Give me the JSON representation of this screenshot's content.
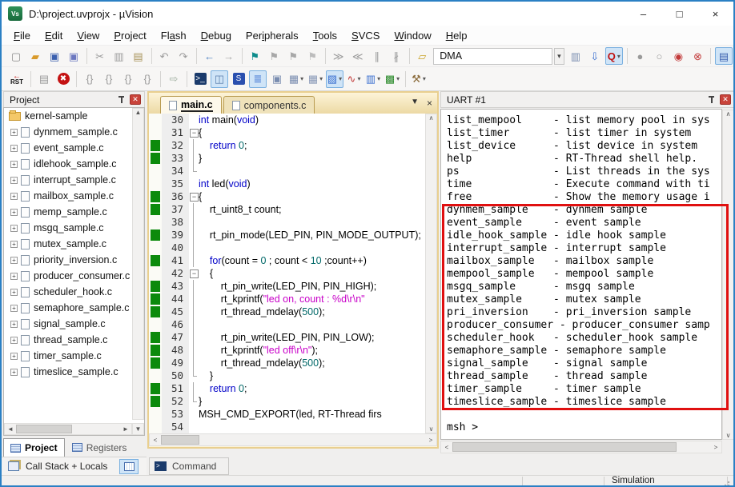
{
  "window": {
    "title": "D:\\project.uvprojx - µVision",
    "logo_text": "Vs",
    "minimize": "–",
    "maximize": "□",
    "close": "×"
  },
  "menu": {
    "items": [
      {
        "label": "File",
        "u": 0
      },
      {
        "label": "Edit",
        "u": 0
      },
      {
        "label": "View",
        "u": 0
      },
      {
        "label": "Project",
        "u": 0
      },
      {
        "label": "Flash",
        "u": 2
      },
      {
        "label": "Debug",
        "u": 0
      },
      {
        "label": "Peripherals",
        "u": 3
      },
      {
        "label": "Tools",
        "u": 0
      },
      {
        "label": "SVCS",
        "u": 0
      },
      {
        "label": "Window",
        "u": 0
      },
      {
        "label": "Help",
        "u": 0
      }
    ]
  },
  "toolbar1": {
    "target_combo_value": "DMA",
    "items": [
      {
        "name": "new-file-button",
        "glyph": "▢",
        "color": "#8a8a8a"
      },
      {
        "name": "open-file-button",
        "glyph": "▰",
        "color": "#d99a2b"
      },
      {
        "name": "save-button",
        "glyph": "▣",
        "color": "#3a5fae"
      },
      {
        "name": "save-all-button",
        "glyph": "▣",
        "color": "#6b77c0"
      },
      {
        "sep": true
      },
      {
        "name": "cut-button",
        "glyph": "✂",
        "color": "#9a9a9a"
      },
      {
        "name": "copy-button",
        "glyph": "▥",
        "color": "#9a9a9a"
      },
      {
        "name": "paste-button",
        "glyph": "▤",
        "color": "#a8935a"
      },
      {
        "sep": true
      },
      {
        "name": "undo-button",
        "glyph": "↶",
        "color": "#9a9a9a"
      },
      {
        "name": "redo-button",
        "glyph": "↷",
        "color": "#9a9a9a"
      },
      {
        "sep": true
      },
      {
        "name": "navigate-back-button",
        "glyph": "←",
        "color": "#4a7fc1"
      },
      {
        "name": "navigate-forward-button",
        "glyph": "→",
        "color": "#a8a8a8"
      },
      {
        "sep": true
      },
      {
        "name": "bookmark-toggle-button",
        "glyph": "⚑",
        "color": "#0e8c8c"
      },
      {
        "name": "bookmark-next-button",
        "glyph": "⚑",
        "color": "#a8a8a8"
      },
      {
        "name": "bookmark-prev-button",
        "glyph": "⚑",
        "color": "#a8a8a8"
      },
      {
        "name": "bookmark-clear-button",
        "glyph": "⚑",
        "color": "#bcbcbc"
      },
      {
        "sep": true
      },
      {
        "name": "indent-button",
        "glyph": "≫",
        "color": "#9a9a9a"
      },
      {
        "name": "outdent-button",
        "glyph": "≪",
        "color": "#9a9a9a"
      },
      {
        "name": "comment-button",
        "glyph": "∥",
        "color": "#9a9a9a"
      },
      {
        "name": "uncomment-button",
        "glyph": "∦",
        "color": "#9a9a9a"
      },
      {
        "sep": true
      },
      {
        "name": "flash-config-button",
        "glyph": "▱",
        "color": "#c9a227"
      },
      {
        "combo": true
      },
      {
        "name": "target-combo-drop-button",
        "glyph": "▾",
        "color": "#444",
        "drop": true
      },
      {
        "name": "find-in-files-button",
        "glyph": "▥",
        "color": "#7a8db0"
      },
      {
        "name": "find-button",
        "glyph": "⇩",
        "color": "#3a6fd0"
      },
      {
        "name": "lookup-button",
        "glyph": "Q",
        "color": "#c01010",
        "hl": true,
        "dd": true
      },
      {
        "sep": true
      },
      {
        "name": "breakpoint-toggle-button",
        "glyph": "●",
        "color": "#9a9a9a"
      },
      {
        "name": "breakpoint-disable-button",
        "glyph": "○",
        "color": "#9a9a9a"
      },
      {
        "name": "breakpoint-disable-all-button",
        "glyph": "◉",
        "color": "#c23a3a"
      },
      {
        "name": "breakpoint-kill-all-button",
        "glyph": "⊗",
        "color": "#c23a3a"
      },
      {
        "sep": true
      },
      {
        "name": "project-window-toggle-button",
        "glyph": "▤",
        "color": "#3a5fae",
        "hl": true
      }
    ]
  },
  "toolbar2": {
    "reset_label": "RST",
    "reset_arrow": "←",
    "items": [
      {
        "name": "reset-cpu-button",
        "rst": true
      },
      {
        "sep": true
      },
      {
        "name": "build-log-button",
        "glyph": "▤",
        "color": "#9a9a9a"
      },
      {
        "name": "stop-debug-button",
        "glyph": "✖",
        "color": "#ffffff",
        "bg": "#c41212",
        "round": true
      },
      {
        "sep": true
      },
      {
        "name": "step-button",
        "glyph": "{}",
        "color": "#9a9a9a"
      },
      {
        "name": "step-over-button",
        "glyph": "{}",
        "color": "#9a9a9a"
      },
      {
        "name": "step-out-button",
        "glyph": "{}",
        "color": "#9a9a9a"
      },
      {
        "name": "run-to-cursor-button",
        "glyph": "{}",
        "color": "#9a9a9a"
      },
      {
        "sep": true
      },
      {
        "name": "run-button",
        "glyph": "⇨",
        "color": "#9fae9f"
      },
      {
        "sep": true
      },
      {
        "name": "command-window-button",
        "glyph": ">_",
        "color": "#ffffff",
        "bg": "#1a3a6b"
      },
      {
        "name": "disassembly-window-button",
        "glyph": "◫",
        "color": "#5a7fae",
        "hl": true
      },
      {
        "name": "symbol-window-button",
        "glyph": "S",
        "color": "#ffffff",
        "bg": "#2a4fae"
      },
      {
        "name": "registers-window-button",
        "glyph": "≣",
        "color": "#3a6fd0",
        "hl": true
      },
      {
        "name": "callstack-window-button",
        "glyph": "▣",
        "color": "#7a8db0"
      },
      {
        "name": "watch-window-button",
        "glyph": "▦",
        "color": "#7a8db0",
        "dd": true
      },
      {
        "name": "memory-window-button",
        "glyph": "▦",
        "color": "#8a9ab8",
        "dd": true
      },
      {
        "name": "serial-window-button",
        "glyph": "▨",
        "color": "#3a6fd0",
        "hl": true,
        "dd": true
      },
      {
        "name": "logic-analyzer-button",
        "glyph": "∿",
        "color": "#c23a3a",
        "dd": true
      },
      {
        "name": "trace-window-button",
        "glyph": "▥",
        "color": "#3a6fd0",
        "dd": true
      },
      {
        "name": "system-viewer-button",
        "glyph": "▩",
        "color": "#2a8a2a",
        "dd": true
      },
      {
        "sep": true
      },
      {
        "name": "toolbox-button",
        "glyph": "⚒",
        "color": "#8a6a3a",
        "dd": true
      }
    ]
  },
  "project_panel": {
    "title": "Project",
    "root": "kernel-sample",
    "files": [
      "dynmem_sample.c",
      "event_sample.c",
      "idlehook_sample.c",
      "interrupt_sample.c",
      "mailbox_sample.c",
      "memp_sample.c",
      "msgq_sample.c",
      "mutex_sample.c",
      "priority_inversion.c",
      "producer_consumer.c",
      "scheduler_hook.c",
      "semaphore_sample.c",
      "signal_sample.c",
      "thread_sample.c",
      "timer_sample.c",
      "timeslice_sample.c"
    ],
    "tabs": [
      {
        "label": "Project",
        "active": true
      },
      {
        "label": "Registers",
        "active": false
      }
    ]
  },
  "callstack_bar": {
    "label": "Call Stack + Locals"
  },
  "command_tab": {
    "label": "Command"
  },
  "editor": {
    "tabs": [
      {
        "label": "main.c",
        "active": true
      },
      {
        "label": "components.c",
        "active": false
      }
    ],
    "lines": [
      {
        "n": 30,
        "m": 0,
        "f": 0,
        "s": [
          [
            "k",
            "int"
          ],
          [
            "p",
            " main("
          ],
          [
            "k",
            "void"
          ],
          [
            "p",
            ")"
          ]
        ]
      },
      {
        "n": 31,
        "m": 0,
        "f": 1,
        "s": [
          [
            "p",
            "{"
          ]
        ]
      },
      {
        "n": 32,
        "m": 1,
        "f": 2,
        "s": [
          [
            "p",
            "    "
          ],
          [
            "k",
            "return"
          ],
          [
            "p",
            " "
          ],
          [
            "n",
            "0"
          ],
          [
            "p",
            ";"
          ]
        ]
      },
      {
        "n": 33,
        "m": 1,
        "f": 2,
        "s": [
          [
            "p",
            "}"
          ]
        ]
      },
      {
        "n": 34,
        "m": 0,
        "f": 3,
        "s": []
      },
      {
        "n": 35,
        "m": 0,
        "f": 0,
        "s": [
          [
            "k",
            "int"
          ],
          [
            "p",
            " led("
          ],
          [
            "k",
            "void"
          ],
          [
            "p",
            ")"
          ]
        ]
      },
      {
        "n": 36,
        "m": 1,
        "f": 1,
        "s": [
          [
            "p",
            "{"
          ]
        ]
      },
      {
        "n": 37,
        "m": 1,
        "f": 2,
        "s": [
          [
            "p",
            "    rt_uint8_t count;"
          ]
        ]
      },
      {
        "n": 38,
        "m": 0,
        "f": 2,
        "s": []
      },
      {
        "n": 39,
        "m": 1,
        "f": 2,
        "s": [
          [
            "p",
            "    rt_pin_mode(LED_PIN, PIN_MODE_OUTPUT);"
          ]
        ]
      },
      {
        "n": 40,
        "m": 0,
        "f": 2,
        "s": []
      },
      {
        "n": 41,
        "m": 1,
        "f": 2,
        "s": [
          [
            "p",
            "    "
          ],
          [
            "k",
            "for"
          ],
          [
            "p",
            "(count = "
          ],
          [
            "n",
            "0"
          ],
          [
            "p",
            " ; count < "
          ],
          [
            "n",
            "10"
          ],
          [
            "p",
            " ;count++)"
          ]
        ]
      },
      {
        "n": 42,
        "m": 0,
        "f": 1,
        "s": [
          [
            "p",
            "    {"
          ]
        ]
      },
      {
        "n": 43,
        "m": 1,
        "f": 2,
        "s": [
          [
            "p",
            "        rt_pin_write(LED_PIN, PIN_HIGH);"
          ]
        ]
      },
      {
        "n": 44,
        "m": 1,
        "f": 2,
        "s": [
          [
            "p",
            "        rt_kprintf("
          ],
          [
            "s",
            "\"led on, count : %d\\r\\n\""
          ]
        ]
      },
      {
        "n": 45,
        "m": 1,
        "f": 2,
        "s": [
          [
            "p",
            "        rt_thread_mdelay("
          ],
          [
            "n",
            "500"
          ],
          [
            "p",
            ");"
          ]
        ]
      },
      {
        "n": 46,
        "m": 0,
        "f": 2,
        "s": []
      },
      {
        "n": 47,
        "m": 1,
        "f": 2,
        "s": [
          [
            "p",
            "        rt_pin_write(LED_PIN, PIN_LOW);"
          ]
        ]
      },
      {
        "n": 48,
        "m": 1,
        "f": 2,
        "s": [
          [
            "p",
            "        rt_kprintf("
          ],
          [
            "s",
            "\"led off\\r\\n\""
          ],
          [
            "p",
            ");"
          ]
        ]
      },
      {
        "n": 49,
        "m": 1,
        "f": 2,
        "s": [
          [
            "p",
            "        rt_thread_mdelay("
          ],
          [
            "n",
            "500"
          ],
          [
            "p",
            ");"
          ]
        ]
      },
      {
        "n": 50,
        "m": 0,
        "f": 3,
        "s": [
          [
            "p",
            "    }"
          ]
        ]
      },
      {
        "n": 51,
        "m": 1,
        "f": 2,
        "s": [
          [
            "p",
            "    "
          ],
          [
            "k",
            "return"
          ],
          [
            "p",
            " "
          ],
          [
            "n",
            "0"
          ],
          [
            "p",
            ";"
          ]
        ]
      },
      {
        "n": 52,
        "m": 1,
        "f": 3,
        "s": [
          [
            "p",
            "}"
          ]
        ]
      },
      {
        "n": 53,
        "m": 0,
        "f": 0,
        "s": [
          [
            "p",
            "MSH_CMD_EXPORT(led, RT-Thread firs"
          ]
        ]
      },
      {
        "n": 54,
        "m": 0,
        "f": 0,
        "s": []
      }
    ],
    "colors": {
      "keyword": "#0000c8",
      "string": "#c800c8",
      "number": "#006868",
      "exec_mark": "#0c8a0c"
    }
  },
  "uart_panel": {
    "title": "UART #1",
    "lines": [
      "list_mempool     - list memory pool in sys",
      "list_timer       - list timer in system",
      "list_device      - list device in system",
      "help             - RT-Thread shell help.",
      "ps               - List threads in the sys",
      "time             - Execute command with ti",
      "free             - Show the memory usage i",
      "dynmem_sample    - dynmem sample",
      "event_sample     - event sample",
      "idle_hook_sample - idle hook sample",
      "interrupt_sample - interrupt sample",
      "mailbox_sample   - mailbox sample",
      "mempool_sample   - mempool sample",
      "msgq_sample      - msgq sample",
      "mutex_sample     - mutex sample",
      "pri_inversion    - pri_inversion sample",
      "producer_consumer - producer_consumer samp",
      "scheduler_hook   - scheduler_hook sample",
      "semaphore_sample - semaphore sample",
      "signal_sample    - signal sample",
      "thread_sample    - thread sample",
      "timer_sample     - timer sample",
      "timeslice_sample - timeslice sample",
      "",
      "msh >"
    ],
    "annotation": {
      "color": "#e01010",
      "first_line": "dynmem_sample",
      "last_line": "timeslice_sample"
    }
  },
  "status_bar": {
    "mode": "Simulation"
  },
  "ui_glyphs": {
    "expand": "+",
    "fold_minus": "−",
    "scroll_up": "▲",
    "scroll_down": "▼",
    "scroll_left": "◄",
    "scroll_right": "►",
    "edit_up": "∧",
    "edit_down": "∨",
    "edit_left": "<",
    "edit_right": ">",
    "tab_list": "▼",
    "tab_close": "×",
    "panel_close": "✕",
    "dropdown": "▾"
  },
  "colors": {
    "window_border": "#2b80c4",
    "highlight_box": "#cfe4f7",
    "annotation_red": "#e01010"
  }
}
